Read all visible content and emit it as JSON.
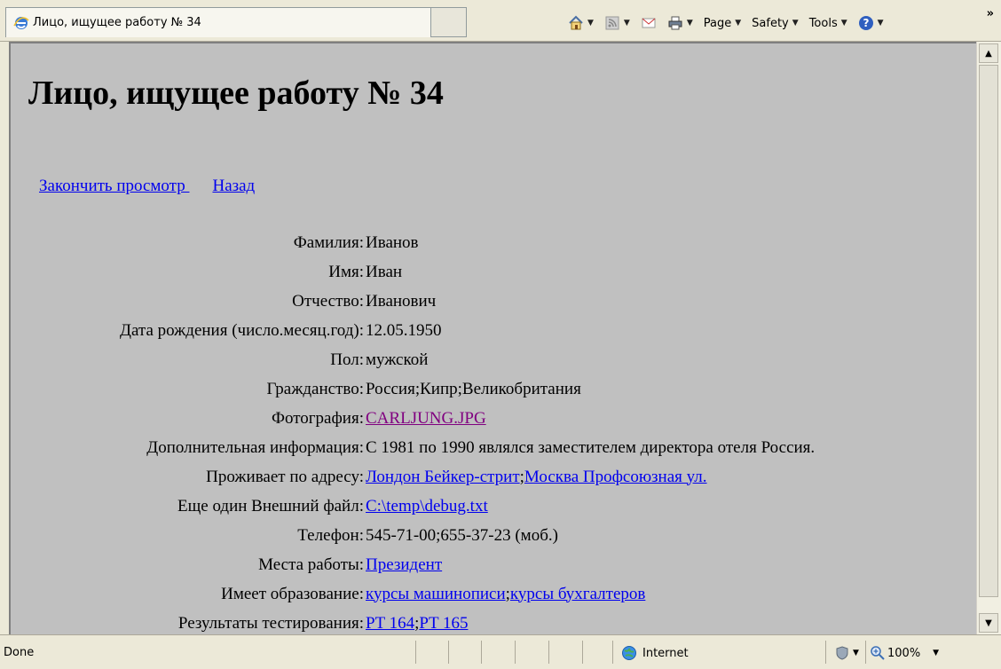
{
  "window": {
    "tab_title": "Лицо, ищущее работу № 34",
    "toolbar": {
      "page": "Page",
      "safety": "Safety",
      "tools": "Tools",
      "overflow": "»"
    }
  },
  "page": {
    "heading": "Лицо, ищущее работу № 34",
    "links": {
      "finish": "Закончить просмотр ",
      "back": "Назад"
    },
    "fields": [
      {
        "label": "Фамилия:",
        "value": "Иванов"
      },
      {
        "label": "Имя:",
        "value": "Иван"
      },
      {
        "label": "Отчество:",
        "value": "Иванович"
      },
      {
        "label": "Дата рождения (число.месяц.год):",
        "value": "12.05.1950"
      },
      {
        "label": "Пол:",
        "value": "мужской"
      },
      {
        "label": "Гражданство:",
        "value": "Россия;Кипр;Великобритания"
      },
      {
        "label": "Фотография:",
        "photo_link": "CARLJUNG.JPG"
      },
      {
        "label": "Дополнительная информация:",
        "value": "С 1981 по 1990 являлся заместителем директора отеля Россия."
      },
      {
        "label": "Проживает по адресу:",
        "address1": "Лондон Бейкер-стрит",
        "sep": ";",
        "address2": "Москва Профсоюзная ул."
      },
      {
        "label": "Еще один Внешний файл:",
        "file_link": "C:\\temp\\debug.txt"
      },
      {
        "label": "Телефон:",
        "value": "545-71-00;655-37-23 (моб.)"
      },
      {
        "label": "Места работы:",
        "work_link": "Президент"
      },
      {
        "label": "Имеет образование:",
        "edu1": "курсы машинописи",
        "sep": ";",
        "edu2": "курсы бухгалтеров"
      },
      {
        "label": "Результаты тестирования:",
        "test1": "PT 164",
        "sep": ";",
        "test2": "PT 165"
      }
    ]
  },
  "statusbar": {
    "status": "Done",
    "zone": "Internet",
    "zoom": "100%"
  },
  "colors": {
    "page_bg": "#c0c0c0",
    "link": "#0000ee",
    "visited": "#800080"
  }
}
